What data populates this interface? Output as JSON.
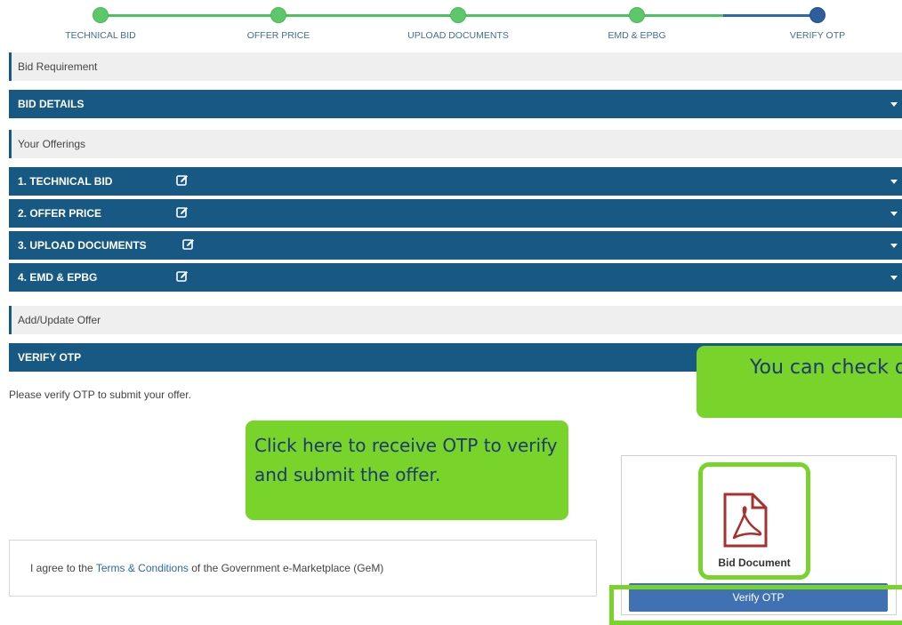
{
  "stepper": {
    "steps": [
      {
        "label": "TECHNICAL BID"
      },
      {
        "label": "OFFER PRICE"
      },
      {
        "label": "UPLOAD DOCUMENTS"
      },
      {
        "label": "EMD & EPBG"
      },
      {
        "label": "VERIFY OTP"
      }
    ],
    "active_step": 5
  },
  "sections": {
    "bid_requirement": "Bid Requirement",
    "bid_details": "BID DETAILS",
    "your_offerings": "Your Offerings",
    "offerings": [
      {
        "label": "1. TECHNICAL BID"
      },
      {
        "label": "2. OFFER PRICE"
      },
      {
        "label": "3. UPLOAD DOCUMENTS"
      },
      {
        "label": "4. EMD & EPBG"
      }
    ],
    "add_update_offer": "Add/Update Offer",
    "verify_otp": "VERIFY OTP"
  },
  "verify_note": "Please verify OTP to submit your offer.",
  "callouts": {
    "otp": "Click here to receive OTP to verify and submit the offer.",
    "check_doc": "You can check document h"
  },
  "terms": {
    "prefix": "I agree to the ",
    "link": "Terms & Conditions",
    "suffix": " of the Government e-Marketplace (GeM)"
  },
  "doc": {
    "label": "Bid Document"
  },
  "verify_button": "Verify OTP",
  "colors": {
    "primary": "#175982",
    "callout": "#78d32b",
    "step_done": "#5cc86a",
    "step_active": "#2c5f9b"
  }
}
